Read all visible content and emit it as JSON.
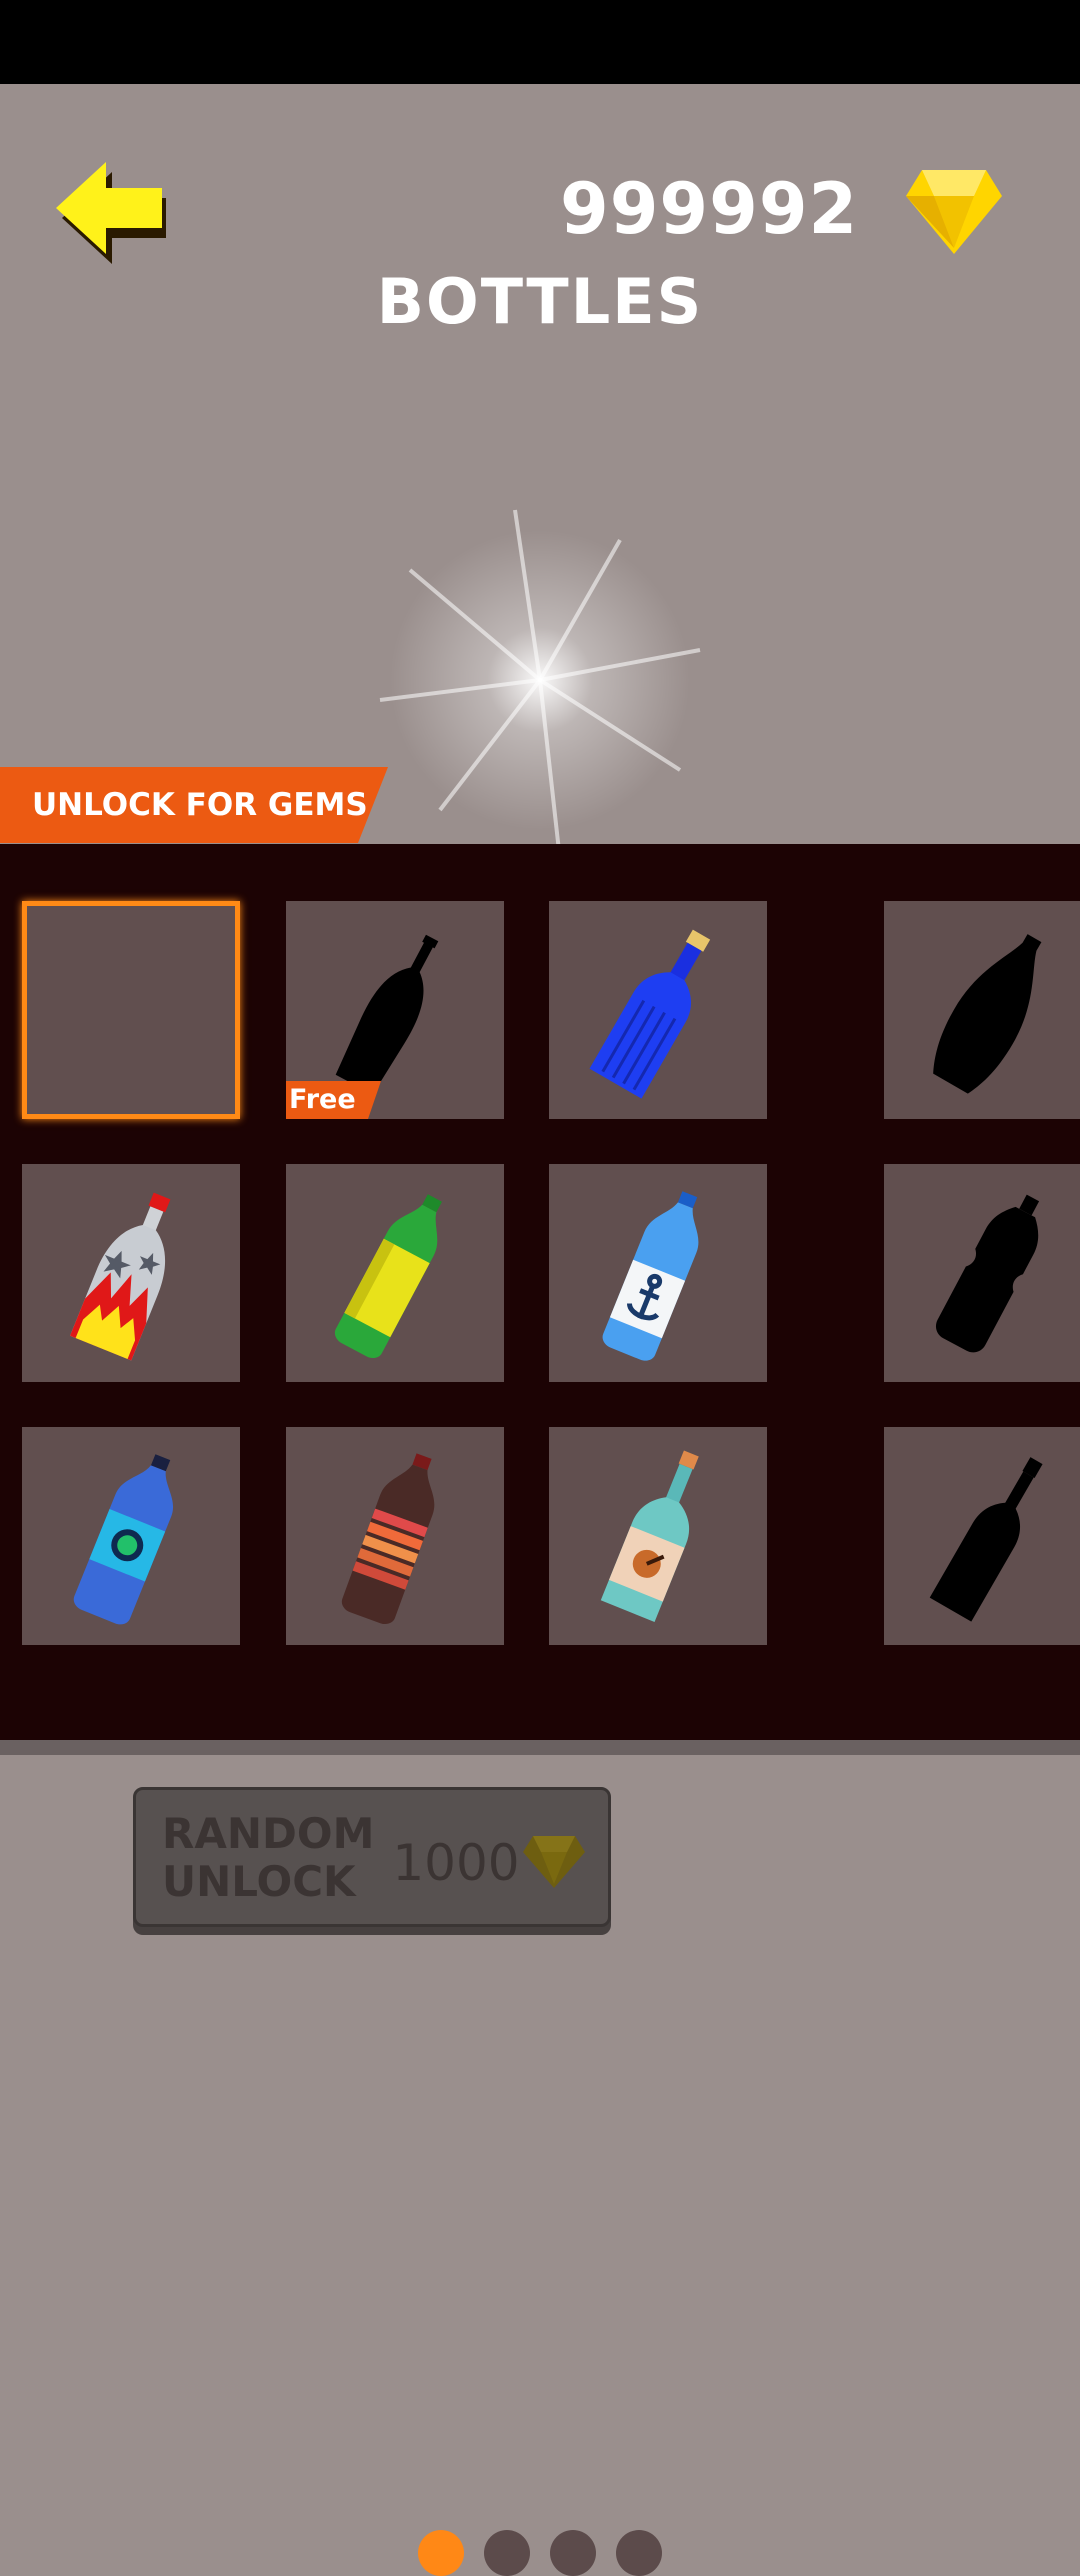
{
  "header": {
    "gem_count": "999992",
    "title": "BOTTLES",
    "gem_icon": "yellow-diamond-gem"
  },
  "banner": {
    "label": "UNLOCK FOR GEMS",
    "color": "#ec5a12"
  },
  "grid": {
    "tiles": [
      {
        "name": "empty-slot",
        "selected": true
      },
      {
        "name": "locked-wine-bottle-silhouette",
        "tag": "Free"
      },
      {
        "name": "blue-cork-bottle"
      },
      {
        "name": "locked-bowling-pin-silhouette"
      },
      {
        "name": "rocket-flame-bottle"
      },
      {
        "name": "yellow-soda-bottle"
      },
      {
        "name": "anchor-water-bottle"
      },
      {
        "name": "locked-sports-bottle-silhouette"
      },
      {
        "name": "blue-logo-bottle"
      },
      {
        "name": "brown-striped-bottle"
      },
      {
        "name": "teal-label-bottle"
      },
      {
        "name": "locked-slim-bottle-silhouette"
      }
    ],
    "active_page": 1,
    "page_count": 4
  },
  "random_unlock": {
    "label": "RANDOM\nUNLOCK",
    "price": "1000",
    "icon": "gem-icon"
  },
  "colors": {
    "background": "#9a8f8d",
    "panel": "#1c0304",
    "tile": "#614f4f",
    "accent": "#ff8816",
    "gem": "#ffd500"
  }
}
